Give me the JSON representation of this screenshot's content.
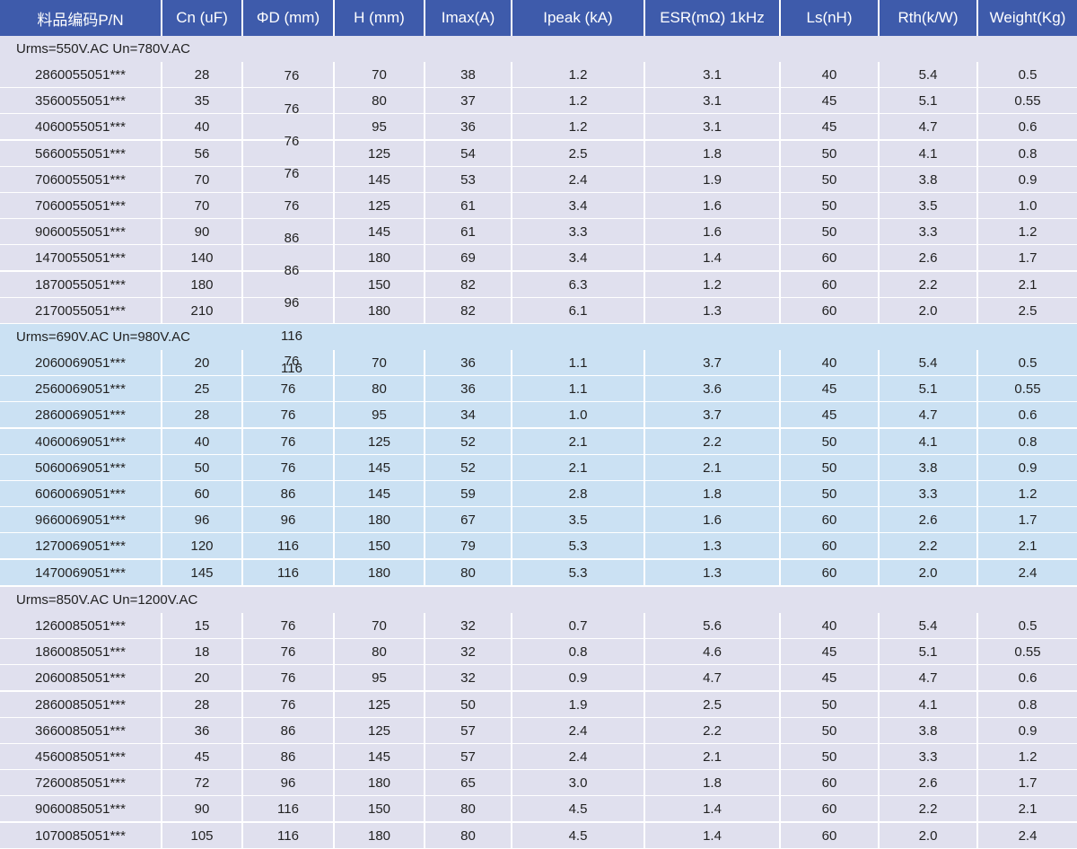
{
  "colors": {
    "header_bg": "#3e5bab",
    "header_text": "#ffffff",
    "group1_bg": "#e0e0ee",
    "group2_bg": "#cbe1f3",
    "group3_bg": "#e0e0ee",
    "grid_line": "#ffffff"
  },
  "columns": [
    "料品编码P/N",
    "Cn (uF)",
    "ΦD (mm)",
    "H (mm)",
    "Imax(A)",
    "Ipeak (kA)",
    "ESR(mΩ) 1kHz",
    "Ls(nH)",
    "Rth(k/W)",
    "Weight(Kg)"
  ],
  "groups": [
    {
      "title": "Urms=550V.AC Un=780V.AC",
      "rows": [
        [
          "2860055051***",
          "28",
          "",
          "70",
          "38",
          "1.2",
          "3.1",
          "40",
          "5.4",
          "0.5"
        ],
        [
          "3560055051***",
          "35",
          "",
          "80",
          "37",
          "1.2",
          "3.1",
          "45",
          "5.1",
          "0.55"
        ],
        [
          "4060055051***",
          "40",
          "",
          "95",
          "36",
          "1.2",
          "3.1",
          "45",
          "4.7",
          "0.6"
        ],
        [
          "5660055051***",
          "56",
          "",
          "125",
          "54",
          "2.5",
          "1.8",
          "50",
          "4.1",
          "0.8"
        ],
        [
          "7060055051***",
          "70",
          "",
          "145",
          "53",
          "2.4",
          "1.9",
          "50",
          "3.8",
          "0.9"
        ],
        [
          "7060055051***",
          "70",
          "",
          "125",
          "61",
          "3.4",
          "1.6",
          "50",
          "3.5",
          "1.0"
        ],
        [
          "9060055051***",
          "90",
          "",
          "145",
          "61",
          "3.3",
          "1.6",
          "50",
          "3.3",
          "1.2"
        ],
        [
          "1470055051***",
          "140",
          "",
          "180",
          "69",
          "3.4",
          "1.4",
          "60",
          "2.6",
          "1.7"
        ],
        [
          "1870055051***",
          "180",
          "",
          "150",
          "82",
          "6.3",
          "1.2",
          "60",
          "2.2",
          "2.1"
        ],
        [
          "2170055051***",
          "210",
          "",
          "180",
          "82",
          "6.1",
          "1.3",
          "60",
          "2.0",
          "2.5"
        ]
      ]
    },
    {
      "title": "Urms=690V.AC Un=980V.AC",
      "rows": [
        [
          "2060069051***",
          "20",
          "",
          "70",
          "36",
          "1.1",
          "3.7",
          "40",
          "5.4",
          "0.5"
        ],
        [
          "2560069051***",
          "25",
          "76",
          "80",
          "36",
          "1.1",
          "3.6",
          "45",
          "5.1",
          "0.55"
        ],
        [
          "2860069051***",
          "28",
          "76",
          "95",
          "34",
          "1.0",
          "3.7",
          "45",
          "4.7",
          "0.6"
        ],
        [
          "4060069051***",
          "40",
          "76",
          "125",
          "52",
          "2.1",
          "2.2",
          "50",
          "4.1",
          "0.8"
        ],
        [
          "5060069051***",
          "50",
          "76",
          "145",
          "52",
          "2.1",
          "2.1",
          "50",
          "3.8",
          "0.9"
        ],
        [
          "6060069051***",
          "60",
          "86",
          "145",
          "59",
          "2.8",
          "1.8",
          "50",
          "3.3",
          "1.2"
        ],
        [
          "9660069051***",
          "96",
          "96",
          "180",
          "67",
          "3.5",
          "1.6",
          "60",
          "2.6",
          "1.7"
        ],
        [
          "1270069051***",
          "120",
          "116",
          "150",
          "79",
          "5.3",
          "1.3",
          "60",
          "2.2",
          "2.1"
        ],
        [
          "1470069051***",
          "145",
          "116",
          "180",
          "80",
          "5.3",
          "1.3",
          "60",
          "2.0",
          "2.4"
        ]
      ]
    },
    {
      "title": "Urms=850V.AC Un=1200V.AC",
      "rows": [
        [
          "1260085051***",
          "15",
          "76",
          "70",
          "32",
          "0.7",
          "5.6",
          "40",
          "5.4",
          "0.5"
        ],
        [
          "1860085051***",
          "18",
          "76",
          "80",
          "32",
          "0.8",
          "4.6",
          "45",
          "5.1",
          "0.55"
        ],
        [
          "2060085051***",
          "20",
          "76",
          "95",
          "32",
          "0.9",
          "4.7",
          "45",
          "4.7",
          "0.6"
        ],
        [
          "2860085051***",
          "28",
          "76",
          "125",
          "50",
          "1.9",
          "2.5",
          "50",
          "4.1",
          "0.8"
        ],
        [
          "3660085051***",
          "36",
          "86",
          "125",
          "57",
          "2.4",
          "2.2",
          "50",
          "3.8",
          "0.9"
        ],
        [
          "4560085051***",
          "45",
          "86",
          "145",
          "57",
          "2.4",
          "2.1",
          "50",
          "3.3",
          "1.2"
        ],
        [
          "7260085051***",
          "72",
          "96",
          "180",
          "65",
          "3.0",
          "1.8",
          "60",
          "2.6",
          "1.7"
        ],
        [
          "9060085051***",
          "90",
          "116",
          "150",
          "80",
          "4.5",
          "1.4",
          "60",
          "2.2",
          "2.1"
        ],
        [
          "1070085051***",
          "105",
          "116",
          "180",
          "80",
          "4.5",
          "1.4",
          "60",
          "2.0",
          "2.4"
        ]
      ]
    }
  ],
  "misaligned_diameter_labels": [
    "76",
    "76",
    "76",
    "76",
    "76",
    "86",
    "86",
    "96",
    "116",
    "76",
    "116"
  ]
}
